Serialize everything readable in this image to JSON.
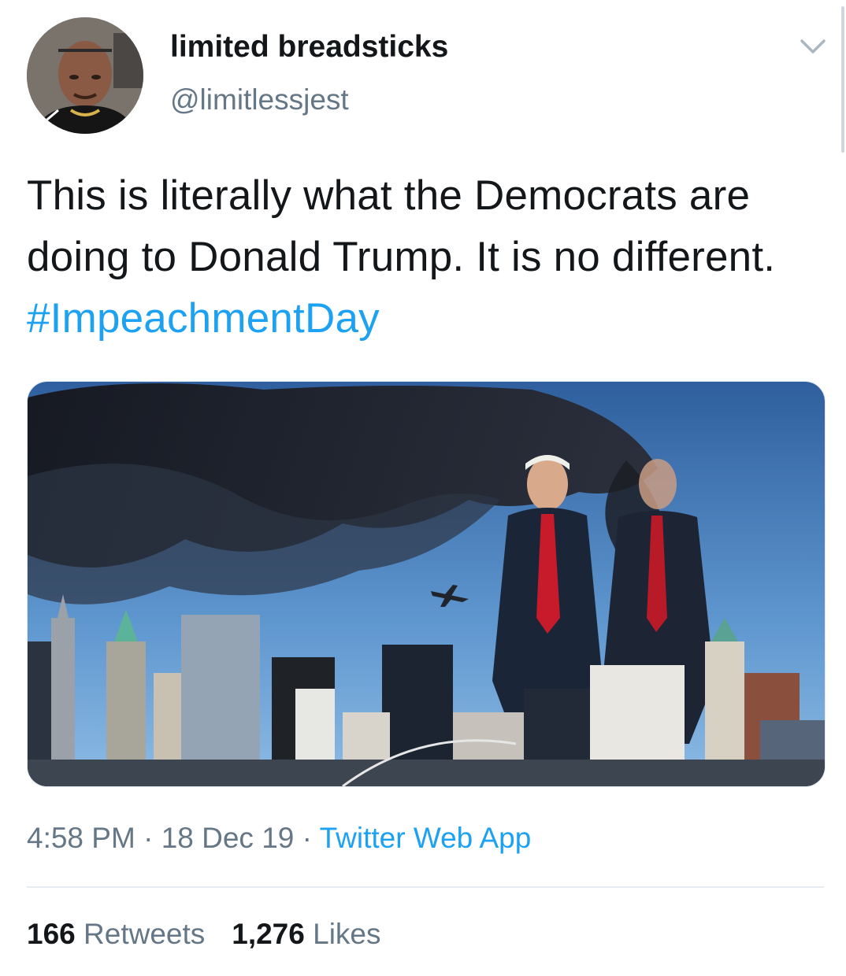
{
  "author": {
    "display_name": "limited breadsticks",
    "handle": "@limitlessjest"
  },
  "tweet": {
    "text_before": "This is literally what the Democrats are doing to Donald Trump. It is no different. ",
    "hashtag": "#ImpeachmentDay"
  },
  "meta": {
    "time": "4:58 PM",
    "separator_1": " · ",
    "date": "18 Dec 19",
    "separator_2": " · ",
    "source": "Twitter Web App"
  },
  "stats": {
    "retweets_count": "166",
    "retweets_label": "Retweets",
    "likes_count": "1,276",
    "likes_label": "Likes"
  },
  "icons": {
    "more_options": "chevron-down-icon"
  },
  "colors": {
    "link_blue": "#1da1f2",
    "secondary_gray": "#657786",
    "text_dark": "#14171a"
  }
}
